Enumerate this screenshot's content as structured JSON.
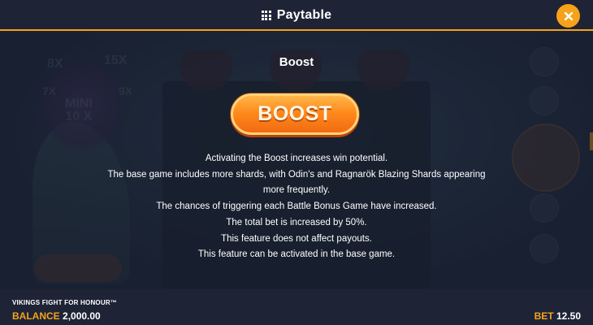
{
  "header": {
    "title": "Paytable",
    "close_icon": "close-icon"
  },
  "section": {
    "title": "Boost",
    "button_label": "BOOST",
    "description": [
      "Activating the Boost increases win potential.",
      "The base game includes more shards, with Odin's and Ragnarök Blazing Shards appearing more frequently.",
      "The chances of triggering each Battle Bonus Game have increased.",
      "The total bet is increased by 50%.",
      "This feature does not affect payouts.",
      "This feature can be activated in the base game."
    ]
  },
  "footer": {
    "game_name": "VIKINGS FIGHT FOR HONOUR™",
    "balance_label": "BALANCE",
    "balance_value": "2,000.00",
    "bet_label": "BET",
    "bet_value": "12.50"
  },
  "colors": {
    "accent": "#f7a21b",
    "panel": "#1e2436",
    "boost_orange": "#ff8a1c"
  }
}
